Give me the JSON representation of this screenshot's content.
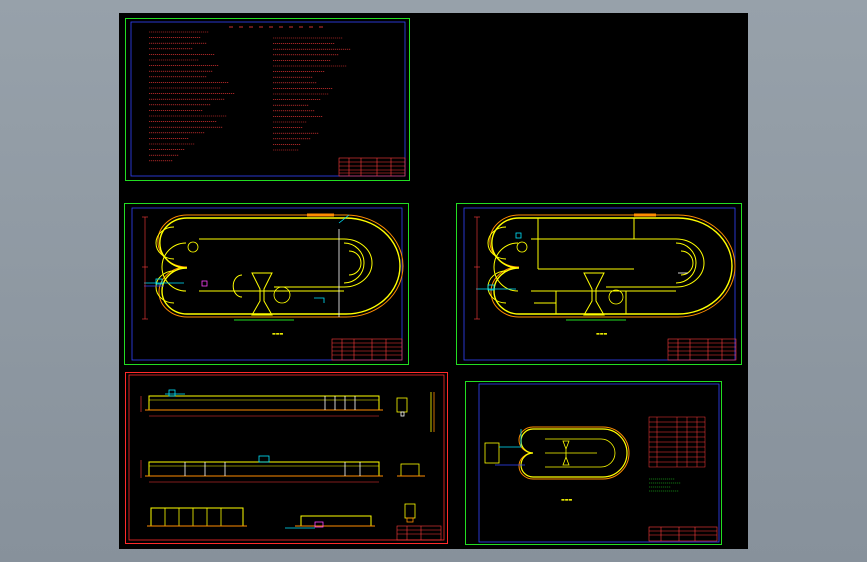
{
  "app": {
    "background_color": "#000000",
    "desktop_color": "#8c96a0"
  },
  "colors": {
    "green_frame": "#22dd22",
    "red_frame": "#ff2a2a",
    "blue_frame": "#3344ff",
    "yellow": "#ffff00",
    "red_text": "#ff3b3b",
    "cyan": "#00e5ff",
    "white": "#ffffff",
    "magenta": "#ff44ff"
  },
  "sheets": [
    {
      "id": "notes-sheet",
      "frame": "green"
    },
    {
      "id": "plan-sheet-1",
      "frame": "green"
    },
    {
      "id": "plan-sheet-2",
      "frame": "green"
    },
    {
      "id": "section-sheet",
      "frame": "red"
    },
    {
      "id": "overview-sheet",
      "frame": "green"
    }
  ]
}
